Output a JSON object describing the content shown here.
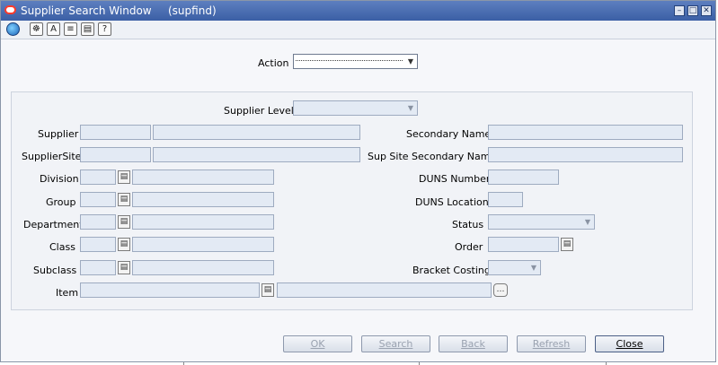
{
  "window": {
    "title": "Supplier Search Window",
    "app_id": "(supfind)"
  },
  "window_buttons": {
    "minimize": "–",
    "maximize": "□",
    "close": "✕"
  },
  "toolbar": {
    "icons": [
      "globe-icon",
      "help-lookup-icon",
      "find-icon",
      "notes-icon",
      "print-icon",
      "help-question-icon"
    ],
    "glyphs": [
      "●",
      "☸",
      "A",
      "≡",
      "▤",
      "?"
    ]
  },
  "action": {
    "label": "Action",
    "value": ""
  },
  "supplier_level": {
    "label": "Supplier Level",
    "value": ""
  },
  "left_labels": {
    "supplier": "Supplier",
    "supplier_site": "SupplierSite",
    "division": "Division",
    "group": "Group",
    "department": "Department",
    "class": "Class",
    "subclass": "Subclass",
    "item": "Item"
  },
  "right_labels": {
    "secondary_name": "Secondary Name",
    "sup_site_secondary_name": "Sup Site Secondary Name",
    "duns_number": "DUNS Number",
    "duns_location": "DUNS Location",
    "status": "Status",
    "order": "Order",
    "bracket_costing": "Bracket Costing"
  },
  "buttons": {
    "ok": "OK",
    "search": "Search",
    "back": "Back",
    "refresh": "Refresh",
    "close": "Close"
  },
  "colors": {
    "titlebar": "#3b5fa5",
    "field_bg": "#e3eaf4",
    "panel_bg": "#f1f3f7"
  }
}
